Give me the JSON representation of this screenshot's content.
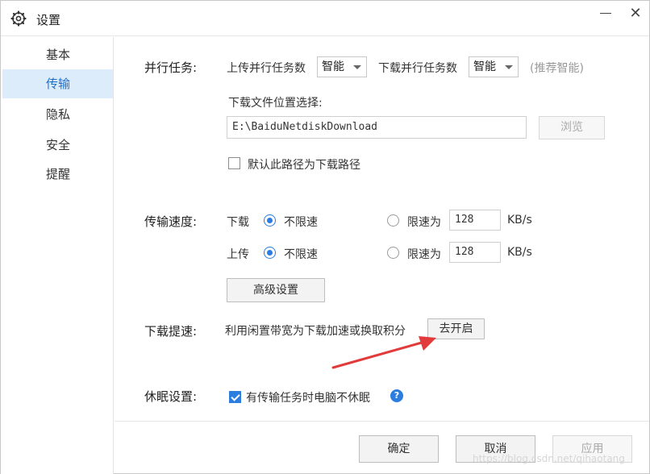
{
  "window": {
    "title": "设置",
    "icons": {
      "settings": "gear-icon",
      "minimize": "minimize-icon",
      "close": "close-icon"
    },
    "close_glyph": "✕"
  },
  "sidebar": {
    "items": [
      {
        "label": "基本",
        "active": false
      },
      {
        "label": "传输",
        "active": true
      },
      {
        "label": "隐私",
        "active": false
      },
      {
        "label": "安全",
        "active": false
      },
      {
        "label": "提醒",
        "active": false
      }
    ]
  },
  "parallel": {
    "section_label": "并行任务:",
    "upload_label": "上传并行任务数",
    "upload_value": "智能",
    "download_label": "下载并行任务数",
    "download_value": "智能",
    "hint": "(推荐智能)"
  },
  "location": {
    "label": "下载文件位置选择:",
    "path": "E:\\BaiduNetdiskDownload",
    "browse_label": "浏览",
    "default_checkbox_label": "默认此路径为下载路径",
    "default_checked": false
  },
  "speed": {
    "section_label": "传输速度:",
    "download": {
      "label": "下载",
      "unlimited_label": "不限速",
      "limit_label": "限速为",
      "limit_value": "128",
      "unit": "KB/s",
      "unlimited_selected": true
    },
    "upload": {
      "label": "上传",
      "unlimited_label": "不限速",
      "limit_label": "限速为",
      "limit_value": "128",
      "unit": "KB/s",
      "unlimited_selected": true
    },
    "advanced_label": "高级设置"
  },
  "boost": {
    "section_label": "下载提速:",
    "description": "利用闲置带宽为下载加速或换取积分",
    "button_label": "去开启"
  },
  "sleep": {
    "section_label": "休眠设置:",
    "checkbox_label": "有传输任务时电脑不休眠",
    "checked": true,
    "help_glyph": "?"
  },
  "footer": {
    "ok_label": "确定",
    "cancel_label": "取消",
    "apply_label": "应用"
  },
  "watermark": "https://blog.csdn.net/qihaotang",
  "colors": {
    "accent": "#2b7de0",
    "active_bg": "#dcecfb",
    "arrow": "#e23b3b"
  }
}
